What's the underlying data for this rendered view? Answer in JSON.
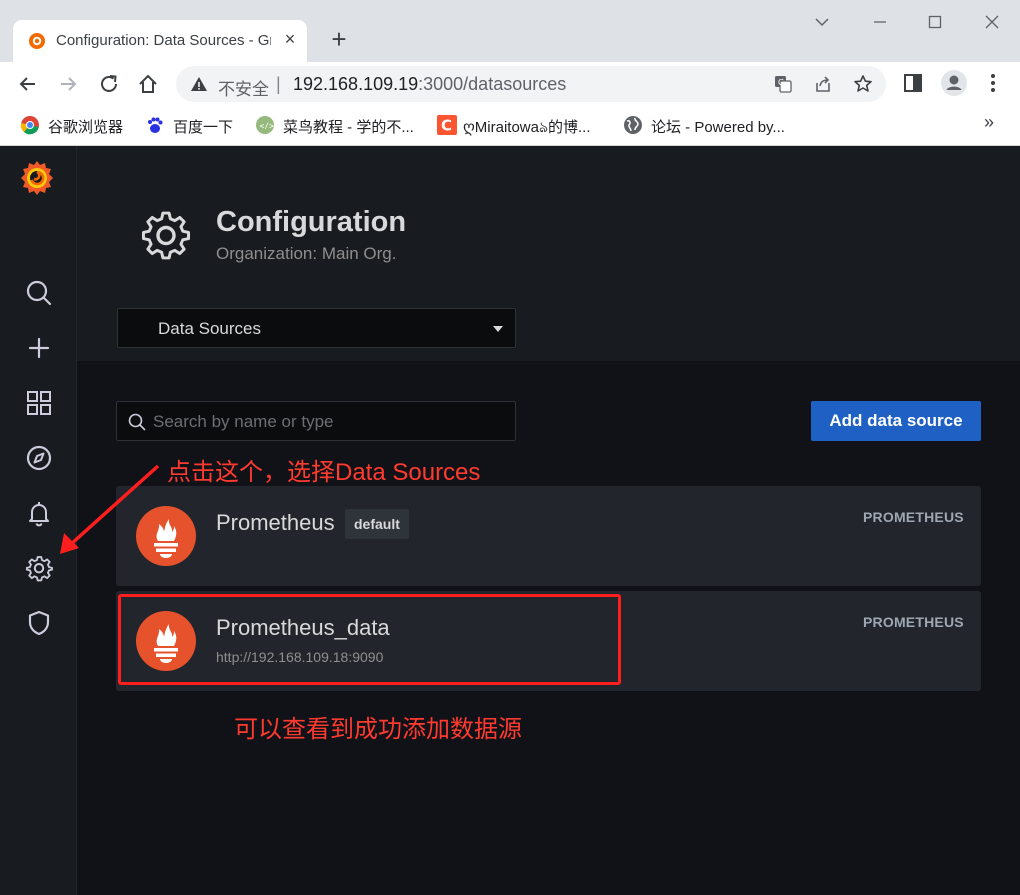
{
  "browser": {
    "tab_title": "Configuration: Data Sources - Grafana",
    "tab_close": "×",
    "new_tab": "+",
    "address": {
      "insecure_label": "不安全",
      "separator": "|",
      "host": "192.168.109.19",
      "path": ":3000/datasources"
    },
    "bookmarks": [
      {
        "label": "谷歌浏览器",
        "icon": "chrome-icon"
      },
      {
        "label": "百度一下",
        "icon": "baidu-icon"
      },
      {
        "label": "菜鸟教程 - 学的不...",
        "icon": "runoob-icon"
      },
      {
        "label": "ღMiraitowaঌ的博...",
        "icon": "csdn-icon"
      },
      {
        "label": "论坛 - Powered by...",
        "icon": "globe-icon"
      }
    ],
    "bookmarks_more": "»"
  },
  "sidebar": {
    "items": [
      "grafana-logo",
      "search-icon",
      "create-icon",
      "dashboards-icon",
      "explore-icon",
      "alerting-icon",
      "configuration-icon",
      "server-admin-icon"
    ]
  },
  "header": {
    "title": "Configuration",
    "subtitle": "Organization: Main Org.",
    "section_select": "Data Sources"
  },
  "actions": {
    "search_placeholder": "Search by name or type",
    "add_label": "Add data source"
  },
  "datasources": [
    {
      "name": "Prometheus",
      "badge": "default",
      "url": "",
      "type": "PROMETHEUS"
    },
    {
      "name": "Prometheus_data",
      "badge": "",
      "url": "http://192.168.109.18:9090",
      "type": "PROMETHEUS"
    }
  ],
  "annotations": {
    "arrow_note": "点击这个，选择Data Sources",
    "result_note": "可以查看到成功添加数据源"
  },
  "colors": {
    "accent": "#1f60c4",
    "annotation": "#ff1e1e",
    "prometheus": "#e6522c"
  }
}
